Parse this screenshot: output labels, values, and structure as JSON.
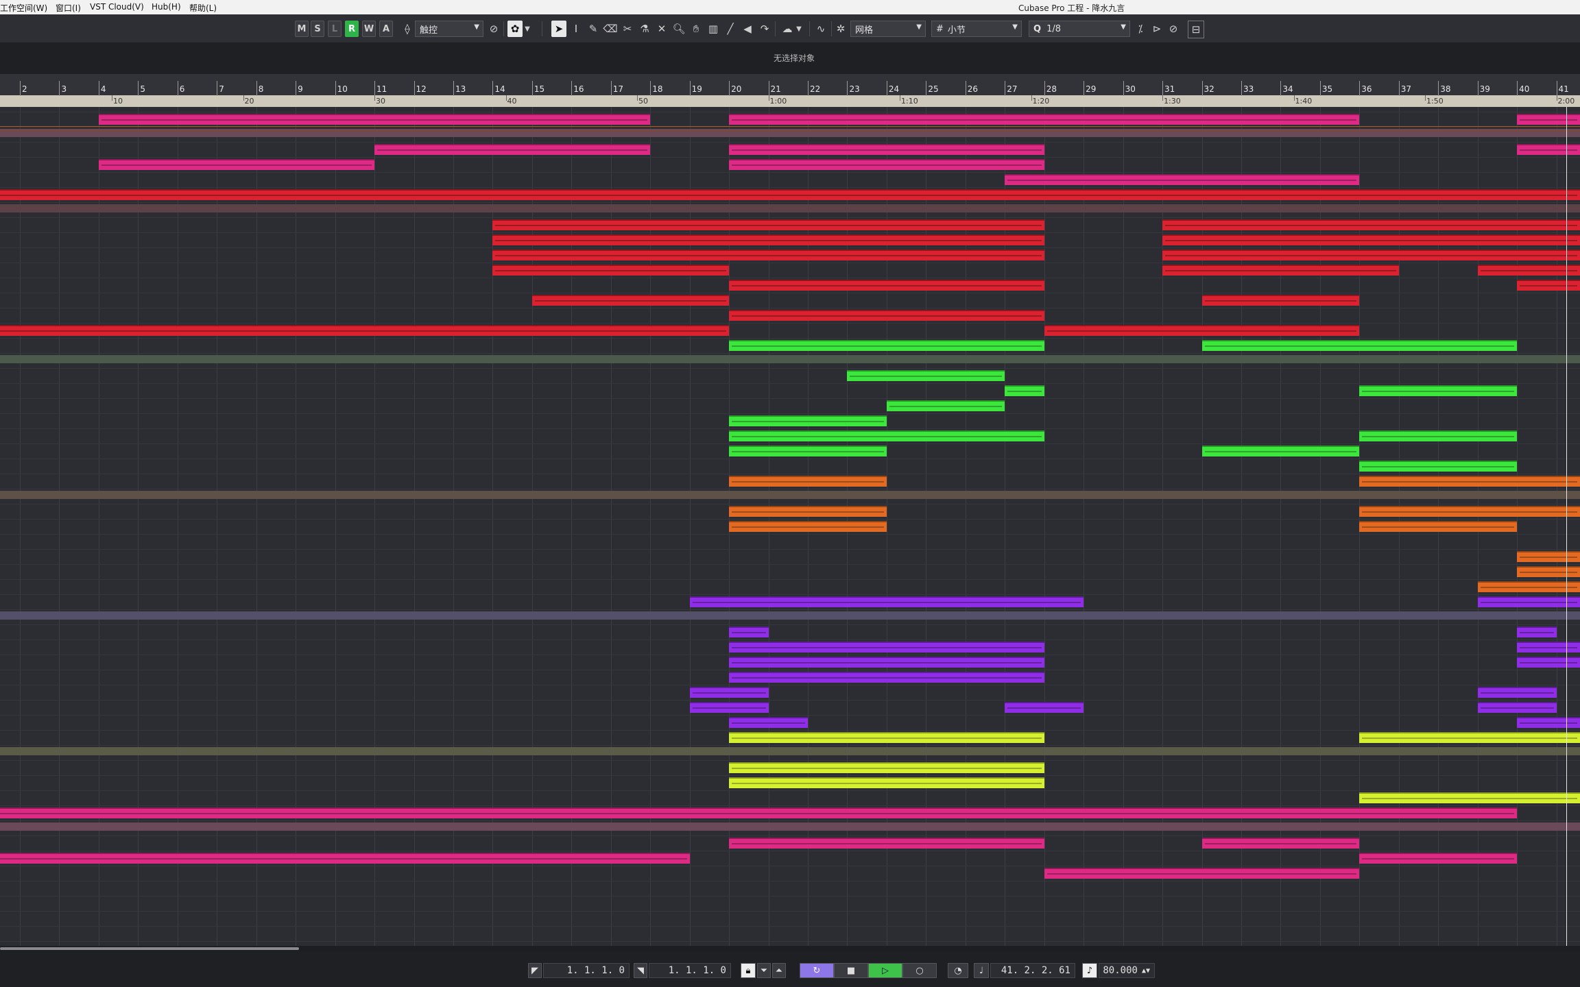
{
  "menu": {
    "workspace": "工作空间(W)",
    "window": "窗口(I)",
    "vst_cloud": "VST Cloud(V)",
    "hub": "Hub(H)",
    "help": "帮助(L)"
  },
  "window_title": "Cubase Pro 工程 - 降水九言",
  "toolbar": {
    "m": "M",
    "s": "S",
    "l": "L",
    "r": "R",
    "w": "W",
    "a": "A",
    "automation_mode": "触控",
    "snap_type": "网格",
    "grid_type": "小节",
    "quantize": "1/8"
  },
  "info_line": "无选择对象",
  "ruler": {
    "bars": [
      "2",
      "3",
      "4",
      "5",
      "6",
      "7",
      "8",
      "9",
      "10",
      "11",
      "12",
      "13",
      "14",
      "15",
      "16",
      "17",
      "18",
      "19",
      "20",
      "21",
      "22",
      "23",
      "24",
      "25",
      "26",
      "27",
      "28",
      "29",
      "30",
      "31",
      "32",
      "33",
      "34",
      "35",
      "36",
      "37",
      "38",
      "39",
      "40",
      "41"
    ],
    "time_labels": [
      "10",
      "20",
      "30",
      "40",
      "50",
      "1:00",
      "1:10",
      "1:20",
      "1:30",
      "1:40",
      "1:50",
      "2:00"
    ]
  },
  "transport": {
    "left_locator": "1. 1. 1.  0",
    "right_locator": "1. 1. 1.  0",
    "position": "41. 2. 2. 61",
    "tempo": "80.000"
  },
  "colors": {
    "pink": "#dd2a85",
    "red": "#db2230",
    "green": "#3ce63c",
    "orange": "#e26a23",
    "purple": "#8f2ee6",
    "yellow": "#d5f030"
  },
  "events": [
    {
      "row": 0,
      "c": "pink",
      "s": 4,
      "e": 18
    },
    {
      "row": 0,
      "c": "pink",
      "s": 20,
      "e": 36
    },
    {
      "row": 0,
      "c": "pink",
      "s": 40,
      "e": 42
    },
    {
      "row": 2,
      "c": "pink",
      "s": 11,
      "e": 18
    },
    {
      "row": 2,
      "c": "pink",
      "s": 20,
      "e": 28
    },
    {
      "row": 2,
      "c": "pink",
      "s": 40,
      "e": 42
    },
    {
      "row": 3,
      "c": "pink",
      "s": 4,
      "e": 11
    },
    {
      "row": 3,
      "c": "pink",
      "s": 20,
      "e": 28
    },
    {
      "row": 4,
      "c": "pink",
      "s": 27,
      "e": 36
    },
    {
      "row": 5,
      "c": "red",
      "s": 1.4,
      "e": 42
    },
    {
      "row": 7,
      "c": "red",
      "s": 14,
      "e": 28
    },
    {
      "row": 7,
      "c": "red",
      "s": 31,
      "e": 42
    },
    {
      "row": 8,
      "c": "red",
      "s": 14,
      "e": 28
    },
    {
      "row": 8,
      "c": "red",
      "s": 31,
      "e": 42
    },
    {
      "row": 9,
      "c": "red",
      "s": 14,
      "e": 28
    },
    {
      "row": 9,
      "c": "red",
      "s": 31,
      "e": 42
    },
    {
      "row": 10,
      "c": "red",
      "s": 14,
      "e": 20
    },
    {
      "row": 10,
      "c": "red",
      "s": 31,
      "e": 37
    },
    {
      "row": 10,
      "c": "red",
      "s": 39,
      "e": 42
    },
    {
      "row": 11,
      "c": "red",
      "s": 20,
      "e": 28
    },
    {
      "row": 11,
      "c": "red",
      "s": 40,
      "e": 42
    },
    {
      "row": 12,
      "c": "red",
      "s": 15,
      "e": 20
    },
    {
      "row": 12,
      "c": "red",
      "s": 32,
      "e": 36
    },
    {
      "row": 13,
      "c": "red",
      "s": 20,
      "e": 28
    },
    {
      "row": 14,
      "c": "red",
      "s": 1.4,
      "e": 20
    },
    {
      "row": 14,
      "c": "red",
      "s": 28,
      "e": 36
    },
    {
      "row": 15,
      "c": "green",
      "s": 20,
      "e": 28
    },
    {
      "row": 15,
      "c": "green",
      "s": 32,
      "e": 40
    },
    {
      "row": 17,
      "c": "green",
      "s": 23,
      "e": 27
    },
    {
      "row": 18,
      "c": "green",
      "s": 27,
      "e": 28
    },
    {
      "row": 18,
      "c": "green",
      "s": 36,
      "e": 40
    },
    {
      "row": 19,
      "c": "green",
      "s": 24,
      "e": 27
    },
    {
      "row": 20,
      "c": "green",
      "s": 20,
      "e": 24
    },
    {
      "row": 21,
      "c": "green",
      "s": 20,
      "e": 28
    },
    {
      "row": 21,
      "c": "green",
      "s": 36,
      "e": 40
    },
    {
      "row": 22,
      "c": "green",
      "s": 20,
      "e": 24
    },
    {
      "row": 22,
      "c": "green",
      "s": 32,
      "e": 36
    },
    {
      "row": 23,
      "c": "green",
      "s": 36,
      "e": 40
    },
    {
      "row": 24,
      "c": "orange",
      "s": 20,
      "e": 24
    },
    {
      "row": 24,
      "c": "orange",
      "s": 36,
      "e": 42
    },
    {
      "row": 26,
      "c": "orange",
      "s": 20,
      "e": 24
    },
    {
      "row": 26,
      "c": "orange",
      "s": 36,
      "e": 42
    },
    {
      "row": 27,
      "c": "orange",
      "s": 20,
      "e": 24
    },
    {
      "row": 27,
      "c": "orange",
      "s": 36,
      "e": 40
    },
    {
      "row": 29,
      "c": "orange",
      "s": 40,
      "e": 42
    },
    {
      "row": 30,
      "c": "orange",
      "s": 40,
      "e": 42
    },
    {
      "row": 31,
      "c": "orange",
      "s": 39,
      "e": 42
    },
    {
      "row": 32,
      "c": "purple",
      "s": 19,
      "e": 29
    },
    {
      "row": 32,
      "c": "purple",
      "s": 39,
      "e": 42
    },
    {
      "row": 34,
      "c": "purple",
      "s": 20,
      "e": 21
    },
    {
      "row": 34,
      "c": "purple",
      "s": 40,
      "e": 41
    },
    {
      "row": 35,
      "c": "purple",
      "s": 20,
      "e": 28
    },
    {
      "row": 35,
      "c": "purple",
      "s": 40,
      "e": 42
    },
    {
      "row": 36,
      "c": "purple",
      "s": 20,
      "e": 28
    },
    {
      "row": 36,
      "c": "purple",
      "s": 40,
      "e": 42
    },
    {
      "row": 37,
      "c": "purple",
      "s": 20,
      "e": 28
    },
    {
      "row": 38,
      "c": "purple",
      "s": 19,
      "e": 21
    },
    {
      "row": 38,
      "c": "purple",
      "s": 39,
      "e": 41
    },
    {
      "row": 39,
      "c": "purple",
      "s": 19,
      "e": 21
    },
    {
      "row": 39,
      "c": "purple",
      "s": 27,
      "e": 29
    },
    {
      "row": 39,
      "c": "purple",
      "s": 39,
      "e": 41
    },
    {
      "row": 40,
      "c": "purple",
      "s": 20,
      "e": 22
    },
    {
      "row": 40,
      "c": "purple",
      "s": 40,
      "e": 42
    },
    {
      "row": 41,
      "c": "yellow",
      "s": 20,
      "e": 28
    },
    {
      "row": 41,
      "c": "yellow",
      "s": 36,
      "e": 42
    },
    {
      "row": 43,
      "c": "yellow",
      "s": 20,
      "e": 28
    },
    {
      "row": 44,
      "c": "yellow",
      "s": 20,
      "e": 28
    },
    {
      "row": 45,
      "c": "yellow",
      "s": 36,
      "e": 42
    },
    {
      "row": 46,
      "c": "pink",
      "s": 1.4,
      "e": 40
    },
    {
      "row": 48,
      "c": "pink",
      "s": 20,
      "e": 28
    },
    {
      "row": 48,
      "c": "pink",
      "s": 32,
      "e": 36
    },
    {
      "row": 49,
      "c": "pink",
      "s": 1.4,
      "e": 19
    },
    {
      "row": 49,
      "c": "pink",
      "s": 36,
      "e": 40
    },
    {
      "row": 50,
      "c": "pink",
      "s": 28,
      "e": 36
    }
  ],
  "folders": [
    {
      "row": 1,
      "c": "pink"
    },
    {
      "row": 6,
      "c": "red"
    },
    {
      "row": 16,
      "c": "green"
    },
    {
      "row": 25,
      "c": "orange"
    },
    {
      "row": 33,
      "c": "purple"
    },
    {
      "row": 42,
      "c": "yellow"
    },
    {
      "row": 47,
      "c": "pink"
    }
  ]
}
